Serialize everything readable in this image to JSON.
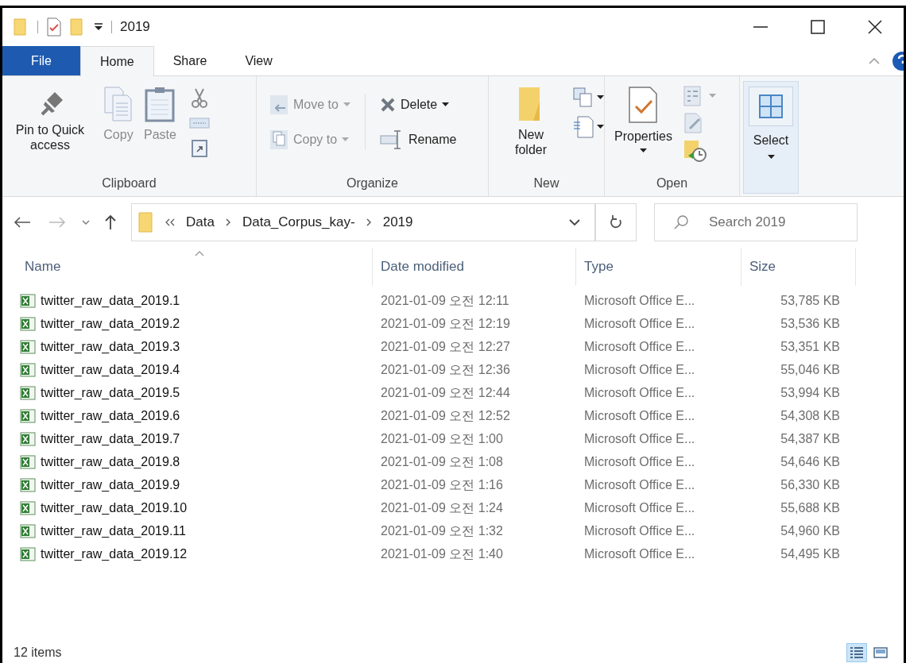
{
  "window": {
    "title": "2019"
  },
  "tabs": [
    {
      "label": "File",
      "kind": "file",
      "selected": false
    },
    {
      "label": "Home",
      "kind": "tab",
      "selected": true
    },
    {
      "label": "Share",
      "kind": "tab",
      "selected": false
    },
    {
      "label": "View",
      "kind": "tab",
      "selected": false
    }
  ],
  "ribbon": {
    "groups": [
      {
        "label": "Clipboard",
        "items": [
          {
            "label": "Pin to Quick access",
            "disabled": false
          },
          {
            "label": "Copy",
            "disabled": true
          },
          {
            "label": "Paste",
            "disabled": true
          }
        ]
      },
      {
        "label": "Organize",
        "items": [
          {
            "label": "Move to",
            "disabled": true
          },
          {
            "label": "Copy to",
            "disabled": true
          },
          {
            "label": "Delete",
            "disabled": false
          },
          {
            "label": "Rename",
            "disabled": false
          }
        ]
      },
      {
        "label": "New",
        "items": [
          {
            "label": "New folder",
            "disabled": false
          }
        ]
      },
      {
        "label": "Open",
        "items": [
          {
            "label": "Properties",
            "disabled": false
          }
        ]
      },
      {
        "items": [
          {
            "label": "Select"
          }
        ]
      }
    ]
  },
  "address": {
    "path": [
      "Data",
      "Data_Corpus_kay-",
      "2019"
    ],
    "search_placeholder": "Search 2019"
  },
  "table": {
    "columns": [
      "Name",
      "Date modified",
      "Type",
      "Size"
    ],
    "rows": [
      {
        "name": "twitter_raw_data_2019.1",
        "date": "2021-01-09 오전 12:11",
        "type": "Microsoft Office E...",
        "size": "53,785 KB"
      },
      {
        "name": "twitter_raw_data_2019.2",
        "date": "2021-01-09 오전 12:19",
        "type": "Microsoft Office E...",
        "size": "53,536 KB"
      },
      {
        "name": "twitter_raw_data_2019.3",
        "date": "2021-01-09 오전 12:27",
        "type": "Microsoft Office E...",
        "size": "53,351 KB"
      },
      {
        "name": "twitter_raw_data_2019.4",
        "date": "2021-01-09 오전 12:36",
        "type": "Microsoft Office E...",
        "size": "55,046 KB"
      },
      {
        "name": "twitter_raw_data_2019.5",
        "date": "2021-01-09 오전 12:44",
        "type": "Microsoft Office E...",
        "size": "53,994 KB"
      },
      {
        "name": "twitter_raw_data_2019.6",
        "date": "2021-01-09 오전 12:52",
        "type": "Microsoft Office E...",
        "size": "54,308 KB"
      },
      {
        "name": "twitter_raw_data_2019.7",
        "date": "2021-01-09 오전 1:00",
        "type": "Microsoft Office E...",
        "size": "54,387 KB"
      },
      {
        "name": "twitter_raw_data_2019.8",
        "date": "2021-01-09 오전 1:08",
        "type": "Microsoft Office E...",
        "size": "54,646 KB"
      },
      {
        "name": "twitter_raw_data_2019.9",
        "date": "2021-01-09 오전 1:16",
        "type": "Microsoft Office E...",
        "size": "56,330 KB"
      },
      {
        "name": "twitter_raw_data_2019.10",
        "date": "2021-01-09 오전 1:24",
        "type": "Microsoft Office E...",
        "size": "55,688 KB"
      },
      {
        "name": "twitter_raw_data_2019.11",
        "date": "2021-01-09 오전 1:32",
        "type": "Microsoft Office E...",
        "size": "54,960 KB"
      },
      {
        "name": "twitter_raw_data_2019.12",
        "date": "2021-01-09 오전 1:40",
        "type": "Microsoft Office E...",
        "size": "54,495 KB"
      }
    ]
  },
  "status_bar": {
    "text": "12 items",
    "views": [
      {
        "kind": "details",
        "selected": true
      },
      {
        "kind": "large",
        "selected": false
      }
    ]
  }
}
